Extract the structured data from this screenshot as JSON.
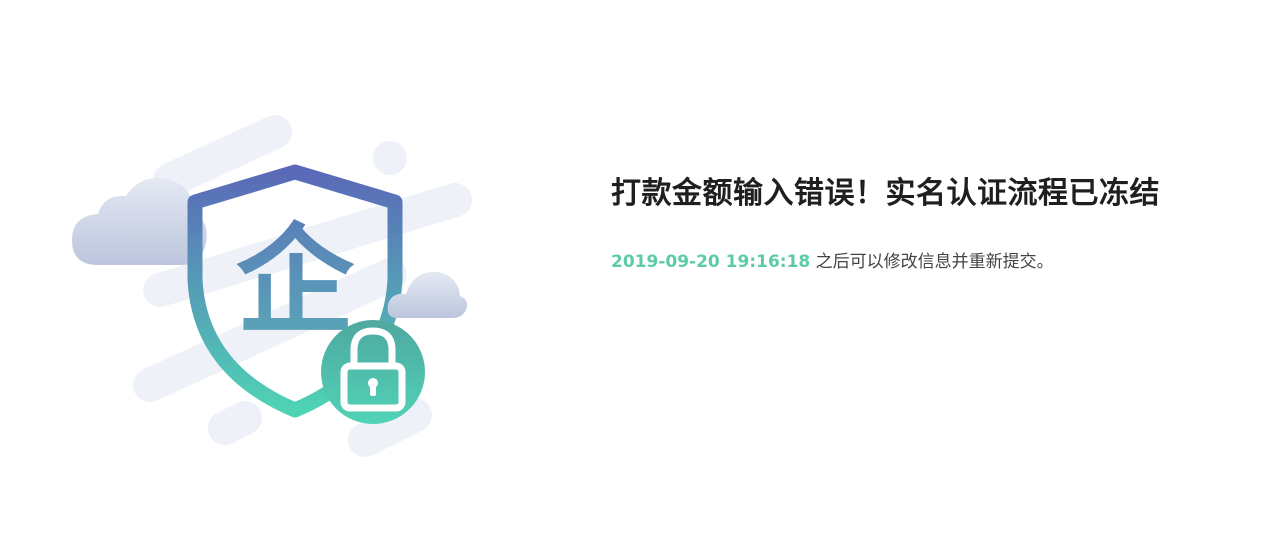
{
  "illustration": {
    "icon": "enterprise-shield-lock-icon",
    "badge_char": "企",
    "colors": {
      "shield_top": "#5a69b8",
      "shield_bottom": "#4fd3b5",
      "cloud": "#c9d2e6",
      "stripe": "#eef1f8"
    }
  },
  "message": {
    "title": "打款金额输入错误！实名认证流程已冻结",
    "unlock_time": "2019-09-20 19:16:18",
    "suffix": " 之后可以修改信息并重新提交。"
  }
}
